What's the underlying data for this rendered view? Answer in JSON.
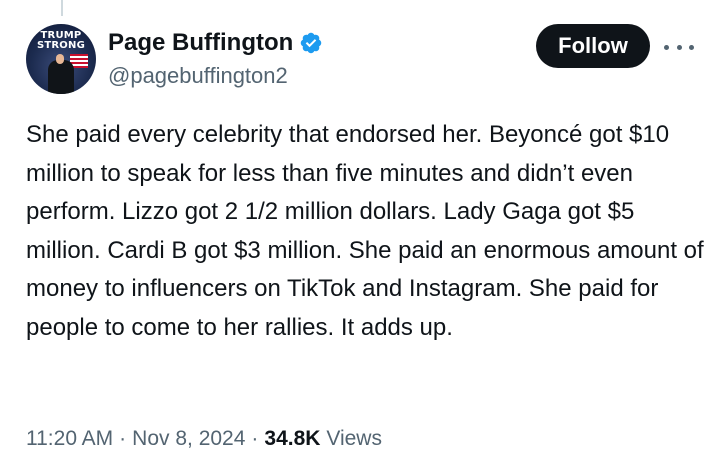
{
  "author": {
    "display_name": "Page Buffington",
    "handle": "@pagebuffington2",
    "verified": true,
    "verified_color": "#1d9bf0",
    "avatar_text_line1": "TRUMP",
    "avatar_text_line2": "STRONG"
  },
  "actions": {
    "follow_label": "Follow",
    "more_icon": "more-horizontal-icon"
  },
  "tweet": {
    "text": "She paid every celebrity that endorsed her. Beyoncé got $10 million to speak for less than five minutes and didn’t even perform. Lizzo got 2 1/2 million dollars. Lady Gaga got $5 million. Cardi B got $3 million. She paid an enormous amount of money to influencers on TikTok and Instagram. She paid for people to come to her rallies. It adds up."
  },
  "meta": {
    "time": "11:20 AM",
    "date": "Nov 8, 2024",
    "separator": "·",
    "views_count": "34.8K",
    "views_label": "Views"
  },
  "colors": {
    "text_primary": "#0f1419",
    "text_secondary": "#536471",
    "button_bg": "#0f1419",
    "button_text": "#ffffff"
  }
}
